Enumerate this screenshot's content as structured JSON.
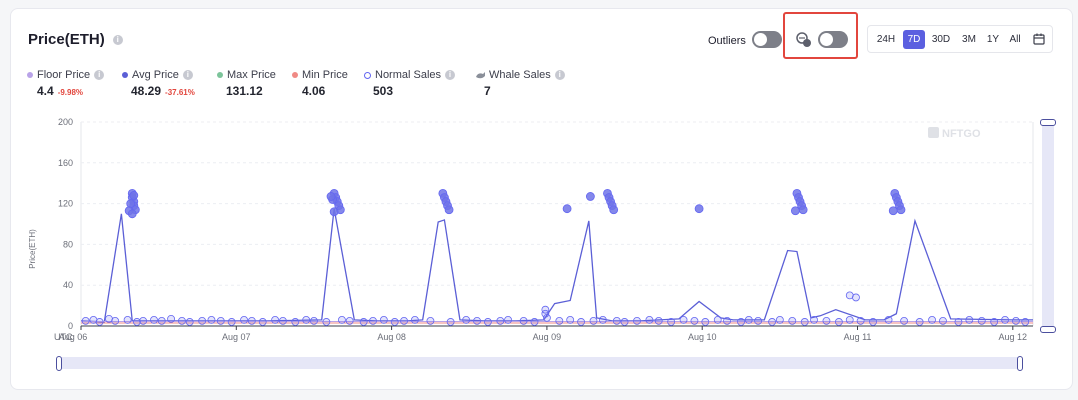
{
  "title": "Price(ETH)",
  "controls": {
    "outliers_label": "Outliers",
    "ranges": [
      "24H",
      "7D",
      "30D",
      "3M",
      "1Y",
      "All"
    ],
    "active_range": "7D"
  },
  "legend": [
    {
      "label": "Floor Price",
      "value": "4.4",
      "change": "-9.98%",
      "color": "#b9a3e8",
      "marker": "dot"
    },
    {
      "label": "Avg Price",
      "value": "48.29",
      "change": "-37.61%",
      "color": "#5b5fd6",
      "marker": "dot"
    },
    {
      "label": "Max Price",
      "value": "131.12",
      "change": "",
      "color": "#7cc49a",
      "marker": "dot"
    },
    {
      "label": "Min Price",
      "value": "4.06",
      "change": "",
      "color": "#f08a85",
      "marker": "dot"
    },
    {
      "label": "Normal Sales",
      "value": "503",
      "change": "",
      "color": "#6366f1",
      "marker": "ring"
    },
    {
      "label": "Whale Sales",
      "value": "7",
      "change": "",
      "color": "#8a8f99",
      "marker": "whale"
    }
  ],
  "watermark": "NFTGO",
  "chart_data": {
    "type": "line",
    "ylabel": "Price(ETH)",
    "ylim": [
      0,
      200
    ],
    "yticks": [
      0,
      40,
      80,
      120,
      160,
      200
    ],
    "timezone_label": "UTC",
    "xlim": [
      0,
      6.13
    ],
    "x_ticks": [
      {
        "x": 0,
        "label": "Aug 06"
      },
      {
        "x": 1,
        "label": "Aug 07"
      },
      {
        "x": 2,
        "label": "Aug 08"
      },
      {
        "x": 3,
        "label": "Aug 09"
      },
      {
        "x": 4,
        "label": "Aug 10"
      },
      {
        "x": 5,
        "label": "Aug 11"
      },
      {
        "x": 6,
        "label": "Aug 12"
      }
    ],
    "series": [
      {
        "name": "Avg Price",
        "color": "#5b5fd6",
        "x": [
          0,
          0.15,
          0.26,
          0.33,
          0.43,
          0.8,
          1.2,
          1.55,
          1.63,
          1.76,
          1.9,
          2.1,
          2.2,
          2.3,
          2.34,
          2.44,
          2.6,
          2.8,
          2.98,
          3.05,
          3.15,
          3.27,
          3.32,
          3.42,
          3.6,
          3.85,
          3.98,
          4.12,
          4.2,
          4.4,
          4.55,
          4.61,
          4.7,
          4.76,
          4.86,
          5.05,
          5.17,
          5.25,
          5.37,
          5.6,
          6.0,
          6.13
        ],
        "y": [
          5,
          4,
          110,
          5,
          5,
          5,
          5,
          6,
          115,
          6,
          5,
          5,
          6,
          102,
          104,
          6,
          5,
          5,
          6,
          22,
          25,
          103,
          8,
          5,
          5,
          7,
          24,
          8,
          6,
          6,
          74,
          73,
          8,
          10,
          16,
          6,
          6,
          12,
          103,
          7,
          6,
          6
        ]
      },
      {
        "name": "Floor Price",
        "color": "#b9a3e8",
        "x": [
          0,
          6.13
        ],
        "y": [
          4.4,
          4.4
        ]
      },
      {
        "name": "Min Price",
        "color": "#f08a85",
        "x": [
          0,
          6.13
        ],
        "y": [
          3,
          3
        ]
      }
    ],
    "scatter": {
      "name": "Normal Sales",
      "color": "#6366f1",
      "points": [
        [
          0.03,
          5
        ],
        [
          0.08,
          6
        ],
        [
          0.12,
          4
        ],
        [
          0.18,
          7
        ],
        [
          0.22,
          5
        ],
        [
          0.3,
          6
        ],
        [
          0.36,
          4
        ],
        [
          0.4,
          5
        ],
        [
          0.47,
          6
        ],
        [
          0.52,
          5
        ],
        [
          0.58,
          7
        ],
        [
          0.65,
          5
        ],
        [
          0.7,
          4
        ],
        [
          0.78,
          5
        ],
        [
          0.84,
          6
        ],
        [
          0.9,
          5
        ],
        [
          0.97,
          4
        ],
        [
          1.05,
          6
        ],
        [
          1.1,
          5
        ],
        [
          1.17,
          4
        ],
        [
          1.25,
          6
        ],
        [
          1.3,
          5
        ],
        [
          1.38,
          4
        ],
        [
          1.45,
          6
        ],
        [
          1.5,
          5
        ],
        [
          1.58,
          4
        ],
        [
          1.68,
          6
        ],
        [
          1.73,
          5
        ],
        [
          1.82,
          4
        ],
        [
          1.88,
          5
        ],
        [
          1.95,
          6
        ],
        [
          2.02,
          4
        ],
        [
          2.08,
          5
        ],
        [
          2.15,
          6
        ],
        [
          2.25,
          5
        ],
        [
          2.38,
          4
        ],
        [
          2.48,
          6
        ],
        [
          2.55,
          5
        ],
        [
          2.62,
          4
        ],
        [
          2.7,
          5
        ],
        [
          2.75,
          6
        ],
        [
          2.85,
          5
        ],
        [
          2.92,
          4
        ],
        [
          2.99,
          12
        ],
        [
          2.99,
          16
        ],
        [
          3.0,
          8
        ],
        [
          3.08,
          5
        ],
        [
          3.15,
          6
        ],
        [
          3.22,
          4
        ],
        [
          3.3,
          5
        ],
        [
          3.36,
          6
        ],
        [
          3.45,
          5
        ],
        [
          3.5,
          4
        ],
        [
          3.58,
          5
        ],
        [
          3.66,
          6
        ],
        [
          3.72,
          5
        ],
        [
          3.8,
          4
        ],
        [
          3.88,
          6
        ],
        [
          3.95,
          5
        ],
        [
          4.02,
          4
        ],
        [
          4.1,
          6
        ],
        [
          4.16,
          5
        ],
        [
          4.25,
          4
        ],
        [
          4.3,
          6
        ],
        [
          4.36,
          5
        ],
        [
          4.45,
          4
        ],
        [
          4.5,
          6
        ],
        [
          4.58,
          5
        ],
        [
          4.66,
          4
        ],
        [
          4.72,
          6
        ],
        [
          4.8,
          5
        ],
        [
          4.88,
          4
        ],
        [
          4.95,
          6
        ],
        [
          5.02,
          5
        ],
        [
          5.1,
          4
        ],
        [
          5.2,
          6
        ],
        [
          5.3,
          5
        ],
        [
          5.4,
          4
        ],
        [
          5.48,
          6
        ],
        [
          5.55,
          5
        ],
        [
          5.65,
          4
        ],
        [
          5.72,
          6
        ],
        [
          5.8,
          5
        ],
        [
          5.88,
          4
        ],
        [
          5.95,
          6
        ],
        [
          6.02,
          5
        ],
        [
          6.08,
          4
        ],
        [
          0.33,
          130
        ],
        [
          0.33,
          126
        ],
        [
          0.34,
          122
        ],
        [
          0.34,
          118
        ],
        [
          0.35,
          114
        ],
        [
          0.32,
          120
        ],
        [
          0.31,
          113
        ],
        [
          0.33,
          110
        ],
        [
          0.34,
          128
        ],
        [
          1.63,
          130
        ],
        [
          1.64,
          126
        ],
        [
          1.65,
          122
        ],
        [
          1.66,
          118
        ],
        [
          1.67,
          114
        ],
        [
          1.62,
          124
        ],
        [
          1.61,
          127
        ],
        [
          1.63,
          112
        ],
        [
          2.33,
          130
        ],
        [
          2.34,
          126
        ],
        [
          2.35,
          122
        ],
        [
          2.36,
          118
        ],
        [
          2.37,
          114
        ],
        [
          3.13,
          115
        ],
        [
          3.28,
          127
        ],
        [
          3.39,
          130
        ],
        [
          3.4,
          126
        ],
        [
          3.41,
          122
        ],
        [
          3.42,
          118
        ],
        [
          3.43,
          114
        ],
        [
          3.98,
          115
        ],
        [
          4.61,
          130
        ],
        [
          4.62,
          126
        ],
        [
          4.63,
          122
        ],
        [
          4.64,
          118
        ],
        [
          4.65,
          114
        ],
        [
          4.6,
          113
        ],
        [
          4.95,
          30
        ],
        [
          4.99,
          28
        ],
        [
          5.24,
          130
        ],
        [
          5.25,
          126
        ],
        [
          5.26,
          122
        ],
        [
          5.27,
          118
        ],
        [
          5.28,
          114
        ],
        [
          5.23,
          113
        ]
      ]
    }
  }
}
